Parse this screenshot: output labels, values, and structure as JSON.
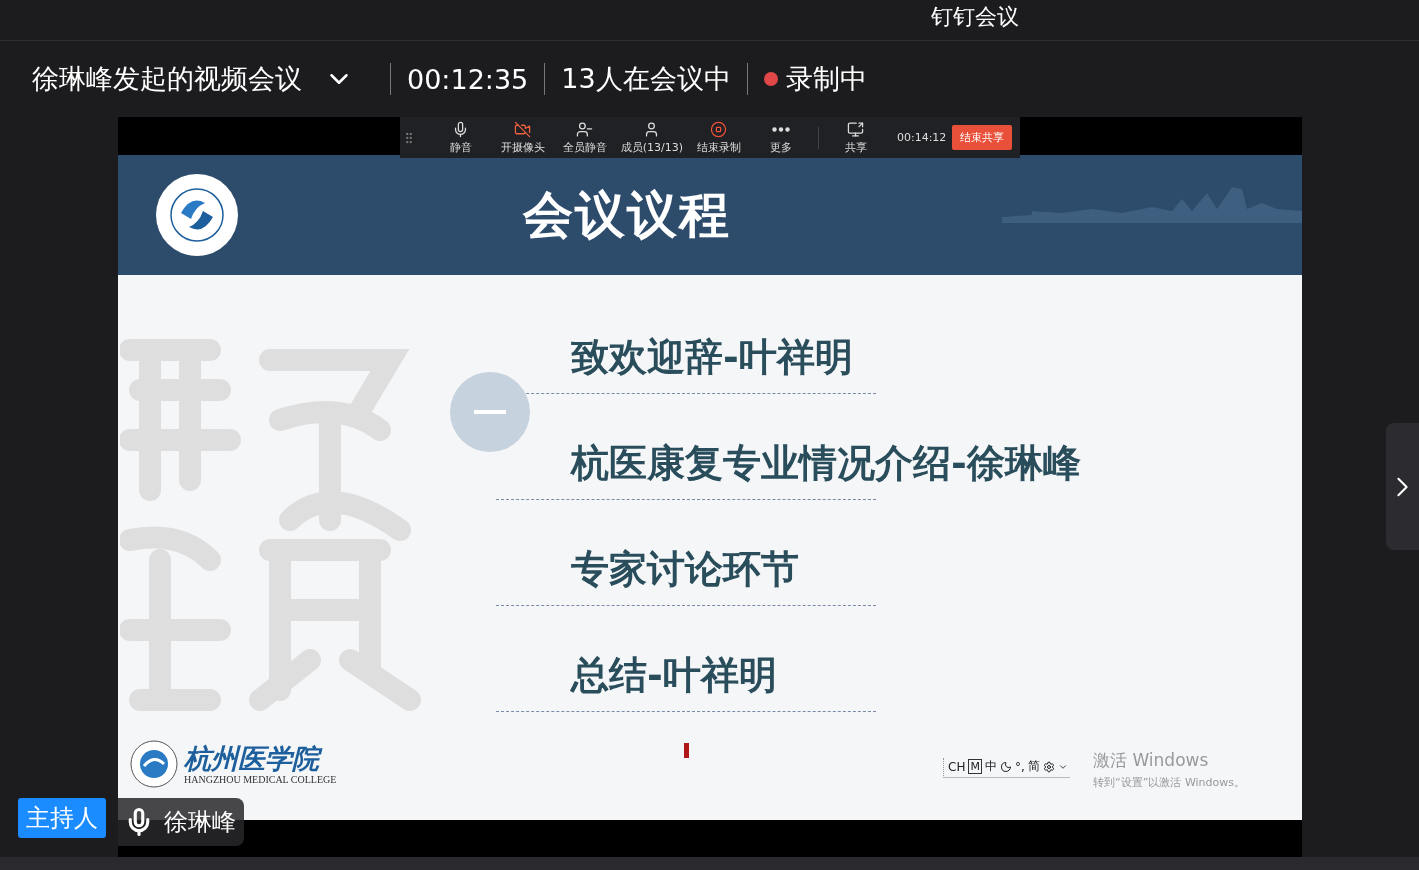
{
  "app_title": "钉钉会议",
  "meeting": {
    "title": "徐琳峰发起的视频会议",
    "duration": "00:12:35",
    "participants": "13人在会议中",
    "recording": {
      "on": true,
      "label": "录制中"
    }
  },
  "share_toolbar": {
    "items": [
      {
        "kind": "mic",
        "label": "静音"
      },
      {
        "kind": "camera",
        "label": "开摄像头"
      },
      {
        "kind": "mute_all",
        "label": "全员静音"
      },
      {
        "kind": "members",
        "label": "成员(13/13)"
      },
      {
        "kind": "record",
        "label": "结束录制"
      },
      {
        "kind": "more",
        "label": "更多"
      },
      {
        "kind": "share",
        "label": "共享"
      }
    ],
    "timer": "00:14:12",
    "end_button": "结束共享"
  },
  "slide": {
    "title": "会议议程",
    "agenda": [
      "致欢迎辞-叶祥明",
      "杭医康复专业情况介绍-徐琳峰",
      "专家讨论环节",
      "总结-叶祥明"
    ],
    "footer_logo": {
      "name": "杭州医学院",
      "english": "HANGZHOU MEDICAL COLLEGE"
    }
  },
  "ime_bar": [
    {
      "kind": "text",
      "text": "CH"
    },
    {
      "kind": "boxed",
      "text": "M"
    },
    {
      "kind": "text",
      "text": "中"
    },
    {
      "kind": "moon"
    },
    {
      "kind": "text",
      "text": "°,"
    },
    {
      "kind": "text",
      "text": "简"
    },
    {
      "kind": "gear"
    },
    {
      "kind": "dropdown"
    }
  ],
  "activation": {
    "title": "激活 Windows",
    "hint": "转到“设置”以激活 Windows。"
  },
  "speaker": {
    "role": "主持人",
    "name": "徐琳峰"
  }
}
